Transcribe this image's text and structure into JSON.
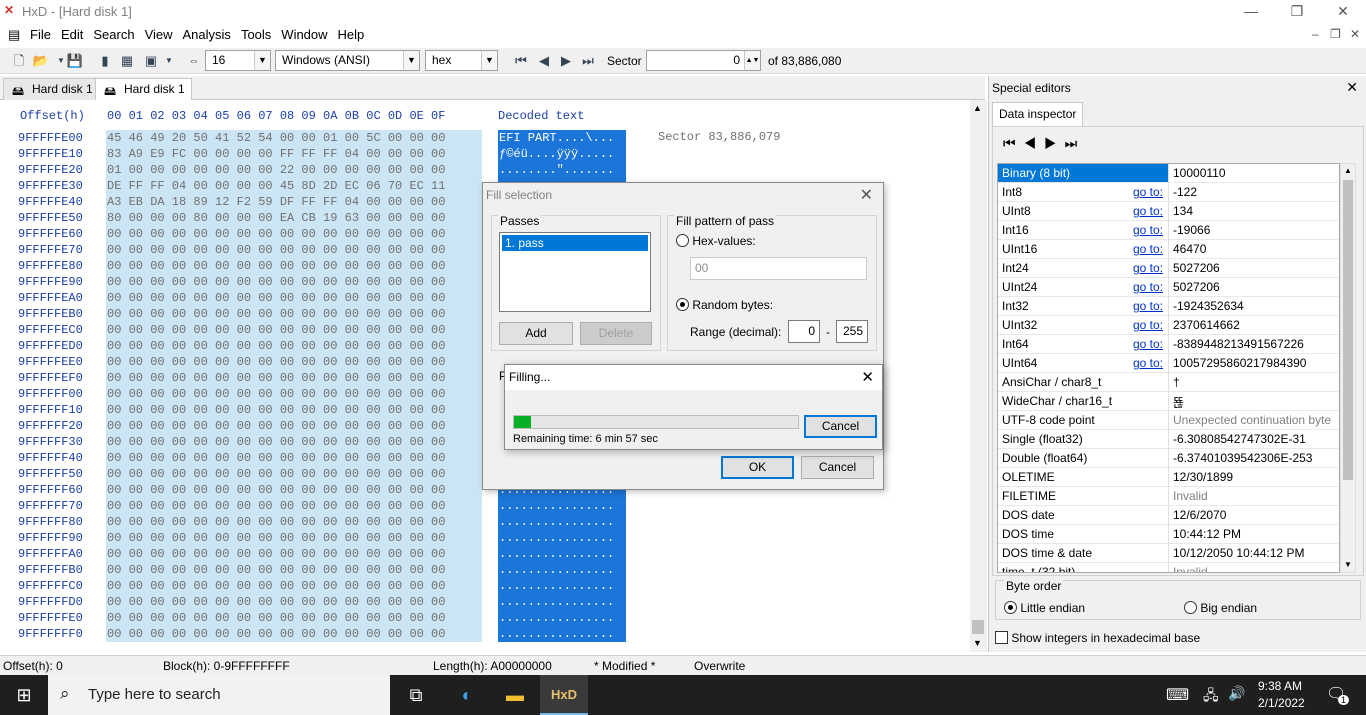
{
  "window": {
    "title": "HxD - [Hard disk 1]",
    "min": "—",
    "max": "❐",
    "close": "✕"
  },
  "menu": [
    "File",
    "Edit",
    "Search",
    "View",
    "Analysis",
    "Tools",
    "Window",
    "Help"
  ],
  "toolbar": {
    "bytes_per_row": "16",
    "charset": "Windows (ANSI)",
    "base": "hex",
    "sector_label": "Sector",
    "sector_value": "0",
    "sector_of": "of 83,886,080"
  },
  "tabs": [
    "Hard disk 1",
    "Hard disk 1"
  ],
  "hex": {
    "offset_header": "Offset(h)",
    "columns": "00 01 02 03 04 05 06 07 08 09 0A 0B 0C 0D 0E 0F",
    "decoded_header": "Decoded text",
    "sector_note": "Sector 83,886,079",
    "offsets": [
      "9FFFFFE00",
      "9FFFFFE10",
      "9FFFFFE20",
      "9FFFFFE30",
      "9FFFFFE40",
      "9FFFFFE50",
      "9FFFFFE60",
      "9FFFFFE70",
      "9FFFFFE80",
      "9FFFFFE90",
      "9FFFFFEA0",
      "9FFFFFEB0",
      "9FFFFFEC0",
      "9FFFFFED0",
      "9FFFFFEE0",
      "9FFFFFEF0",
      "9FFFFFF00",
      "9FFFFFF10",
      "9FFFFFF20",
      "9FFFFFF30",
      "9FFFFFF40",
      "9FFFFFF50",
      "9FFFFFF60",
      "9FFFFFF70",
      "9FFFFFF80",
      "9FFFFFF90",
      "9FFFFFFA0",
      "9FFFFFFB0",
      "9FFFFFFC0",
      "9FFFFFFD0",
      "9FFFFFFE0",
      "9FFFFFFF0"
    ],
    "rows": [
      "45 46 49 20 50 41 52 54 00 00 01 00 5C 00 00 00",
      "83 A9 E9 FC 00 00 00 00 FF FF FF 04 00 00 00 00",
      "01 00 00 00 00 00 00 00 22 00 00 00 00 00 00 00",
      "DE FF FF 04 00 00 00 00 45 8D 2D EC 06 70 EC 11",
      "A3 EB DA 18 89 12 F2 59 DF FF FF 04 00 00 00 00",
      "80 00 00 00 80 00 00 00 EA CB 19 63 00 00 00 00"
    ],
    "zero_row": "00 00 00 00 00 00 00 00 00 00 00 00 00 00 00 00",
    "decoded_rows": [
      "EFI PART....\\...",
      "ƒ©éü....ÿÿÿ.....",
      "........\"......."
    ],
    "decoded_fill": "................"
  },
  "special_editors": {
    "title": "Special editors",
    "tab": "Data inspector",
    "rows": [
      {
        "name": "Binary (8 bit)",
        "goto": "",
        "value": "10000110",
        "selected": true
      },
      {
        "name": "Int8",
        "goto": "go to:",
        "value": "-122"
      },
      {
        "name": "UInt8",
        "goto": "go to:",
        "value": "134"
      },
      {
        "name": "Int16",
        "goto": "go to:",
        "value": "-19066"
      },
      {
        "name": "UInt16",
        "goto": "go to:",
        "value": "46470"
      },
      {
        "name": "Int24",
        "goto": "go to:",
        "value": "5027206"
      },
      {
        "name": "UInt24",
        "goto": "go to:",
        "value": "5027206"
      },
      {
        "name": "Int32",
        "goto": "go to:",
        "value": "-1924352634"
      },
      {
        "name": "UInt32",
        "goto": "go to:",
        "value": "2370614662"
      },
      {
        "name": "Int64",
        "goto": "go to:",
        "value": "-8389448213491567226"
      },
      {
        "name": "UInt64",
        "goto": "go to:",
        "value": "10057295860217984390"
      },
      {
        "name": "AnsiChar / char8_t",
        "goto": "",
        "value": "†"
      },
      {
        "name": "WideChar / char16_t",
        "goto": "",
        "value": "뚆"
      },
      {
        "name": "UTF-8 code point",
        "goto": "",
        "value": "Unexpected continuation byte",
        "grey": true
      },
      {
        "name": "Single (float32)",
        "goto": "",
        "value": "-6.30808542747302E-31"
      },
      {
        "name": "Double (float64)",
        "goto": "",
        "value": "-6.37401039542306E-253"
      },
      {
        "name": "OLETIME",
        "goto": "",
        "value": "12/30/1899"
      },
      {
        "name": "FILETIME",
        "goto": "",
        "value": "Invalid",
        "grey": true
      },
      {
        "name": "DOS date",
        "goto": "",
        "value": "12/6/2070"
      },
      {
        "name": "DOS time",
        "goto": "",
        "value": "10:44:12 PM"
      },
      {
        "name": "DOS time & date",
        "goto": "",
        "value": "10/12/2050 10:44:12 PM"
      },
      {
        "name": "time_t (32 bit)",
        "goto": "",
        "value": "Invalid",
        "grey": true
      }
    ],
    "byte_order_label": "Byte order",
    "little_endian": "Little endian",
    "big_endian": "Big endian",
    "hex_ints": "Show integers in hexadecimal base"
  },
  "fill_dialog": {
    "title": "Fill selection",
    "passes_label": "Passes",
    "pass_item": "1. pass",
    "add": "Add",
    "delete": "Delete",
    "pattern_label": "Fill pattern of pass",
    "hex_values": "Hex-values:",
    "hex_value": "00",
    "random_bytes": "Random bytes:",
    "range_label": "Range (decimal):",
    "range_from": "0",
    "range_sep": "-",
    "range_to": "255",
    "ok": "OK",
    "cancel": "Cancel"
  },
  "filling": {
    "title": "Filling...",
    "remaining": "Remaining time: 6 min 57 sec",
    "cancel": "Cancel",
    "progress": 0.06
  },
  "status": {
    "offset": "Offset(h): 0",
    "block": "Block(h): 0-9FFFFFFFF",
    "length": "Length(h): A00000000",
    "modified": "* Modified *",
    "mode": "Overwrite"
  },
  "taskbar": {
    "search_placeholder": "Type here to search",
    "time": "9:38 AM",
    "date": "2/1/2022",
    "notif_count": "1"
  }
}
